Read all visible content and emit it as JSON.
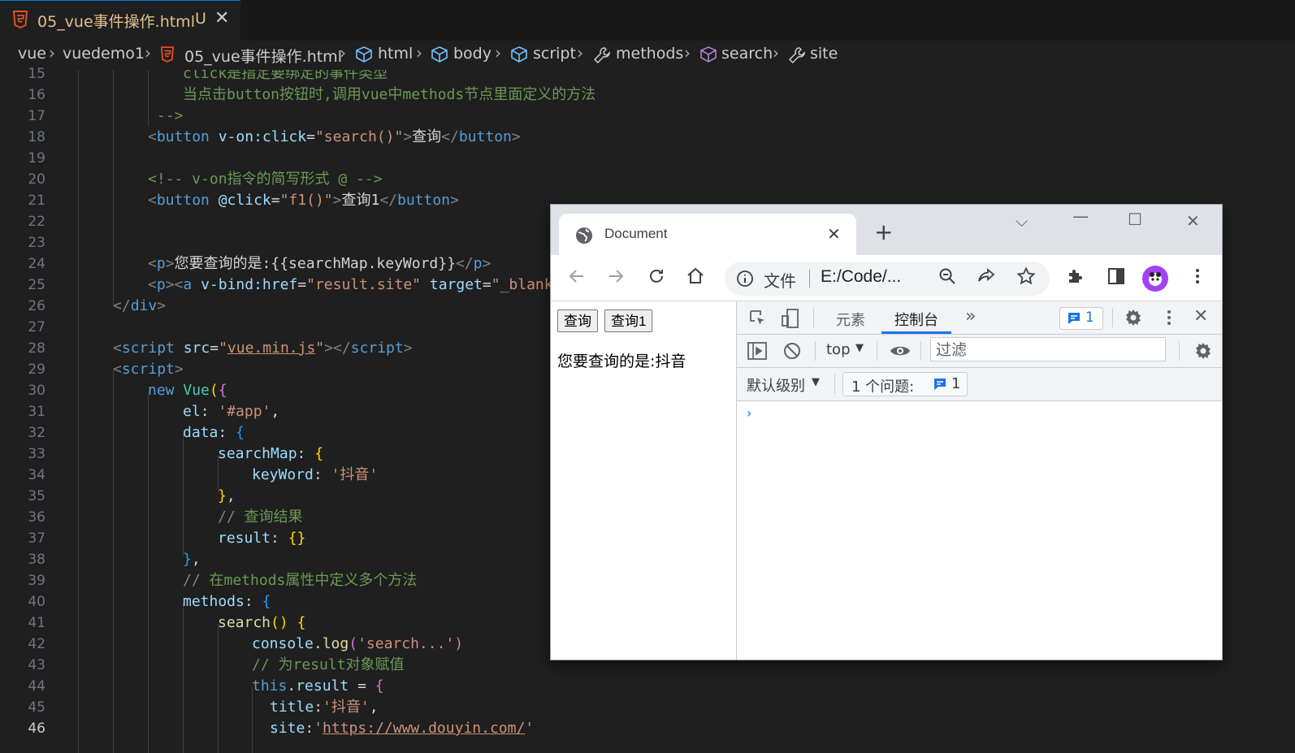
{
  "editor": {
    "tab": {
      "filename": "05_vue事件操作.html",
      "status": "U",
      "close": "✕"
    },
    "breadcrumb": [
      "vue",
      "vuedemo1",
      "05_vue事件操作.html",
      "html",
      "body",
      "script",
      "methods",
      "search",
      "site"
    ],
    "line_numbers": [
      "15",
      "16",
      "17",
      "18",
      "19",
      "20",
      "21",
      "22",
      "23",
      "24",
      "25",
      "26",
      "27",
      "28",
      "29",
      "30",
      "31",
      "32",
      "33",
      "34",
      "35",
      "36",
      "37",
      "38",
      "39",
      "40",
      "41",
      "42",
      "43",
      "44",
      "45",
      "46"
    ],
    "current_line": "46",
    "code": {
      "l15_text": "click是指定要绑定的事件类型",
      "l16_text": "当点击button按钮时,调用vue中methods节点里面定义的方法",
      "l17_close": "-->",
      "l18_tag": "button",
      "l18_attr": "v-on:click",
      "l18_val": "\"search()\"",
      "l18_text": "查询",
      "l20_comment": "<!-- v-on指令的简写形式 @ -->",
      "l21_tag": "button",
      "l21_attr": "@click",
      "l21_val": "\"f1()\"",
      "l21_text": "查询1",
      "l24_tag": "p",
      "l24_text": "您要查询的是:{{searchMap.keyWord}}",
      "l25_p": "p",
      "l25_a": "a",
      "l25_attr1": "v-bind:href",
      "l25_val1": "\"result.site\"",
      "l25_attr2": "target",
      "l25_val2": "\"_blank",
      "l26_tag": "div",
      "l28_tag": "script",
      "l28_attr": "src",
      "l28_val": "vue.min.js",
      "l29_tag": "script",
      "l30_new": "new",
      "l30_cls": "Vue",
      "l31_key": "el",
      "l31_val": "'#app'",
      "l32_key": "data",
      "l33_key": "searchMap",
      "l34_key": "keyWord",
      "l34_val": "'抖音'",
      "l36_comment": "// 查询结果",
      "l37_key": "result",
      "l39_comment": "// 在methods属性中定义多个方法",
      "l40_key": "methods",
      "l41_fn": "search",
      "l42_obj": "console",
      "l42_fn": "log",
      "l42_val": "'search...'",
      "l43_comment": "// 为result对象赋值",
      "l44_kw": "this",
      "l44_prop": "result",
      "l45_key": "title",
      "l45_val": "'抖音'",
      "l46_key": "site",
      "l46_val_url": "https://www.douyin.com/"
    }
  },
  "browser": {
    "tab_title": "Document",
    "omnibox": {
      "scheme_label": "文件",
      "url": "E:/Code/..."
    },
    "page": {
      "button1": "查询",
      "button2": "查询1",
      "text": "您要查询的是:抖音"
    },
    "devtools": {
      "tabs": [
        "元素",
        "控制台"
      ],
      "active_tab": "控制台",
      "more": "»",
      "issue_badge": "1",
      "context": "top",
      "filter_placeholder": "过滤",
      "level": "默认级别",
      "issues_label": "1 个问题:",
      "issues_count": "1",
      "prompt": "›"
    }
  },
  "colors": {
    "editor_bg": "#1f1f1f",
    "tab_modified": "#e2c08d",
    "devtools_accent": "#1a73e8"
  }
}
